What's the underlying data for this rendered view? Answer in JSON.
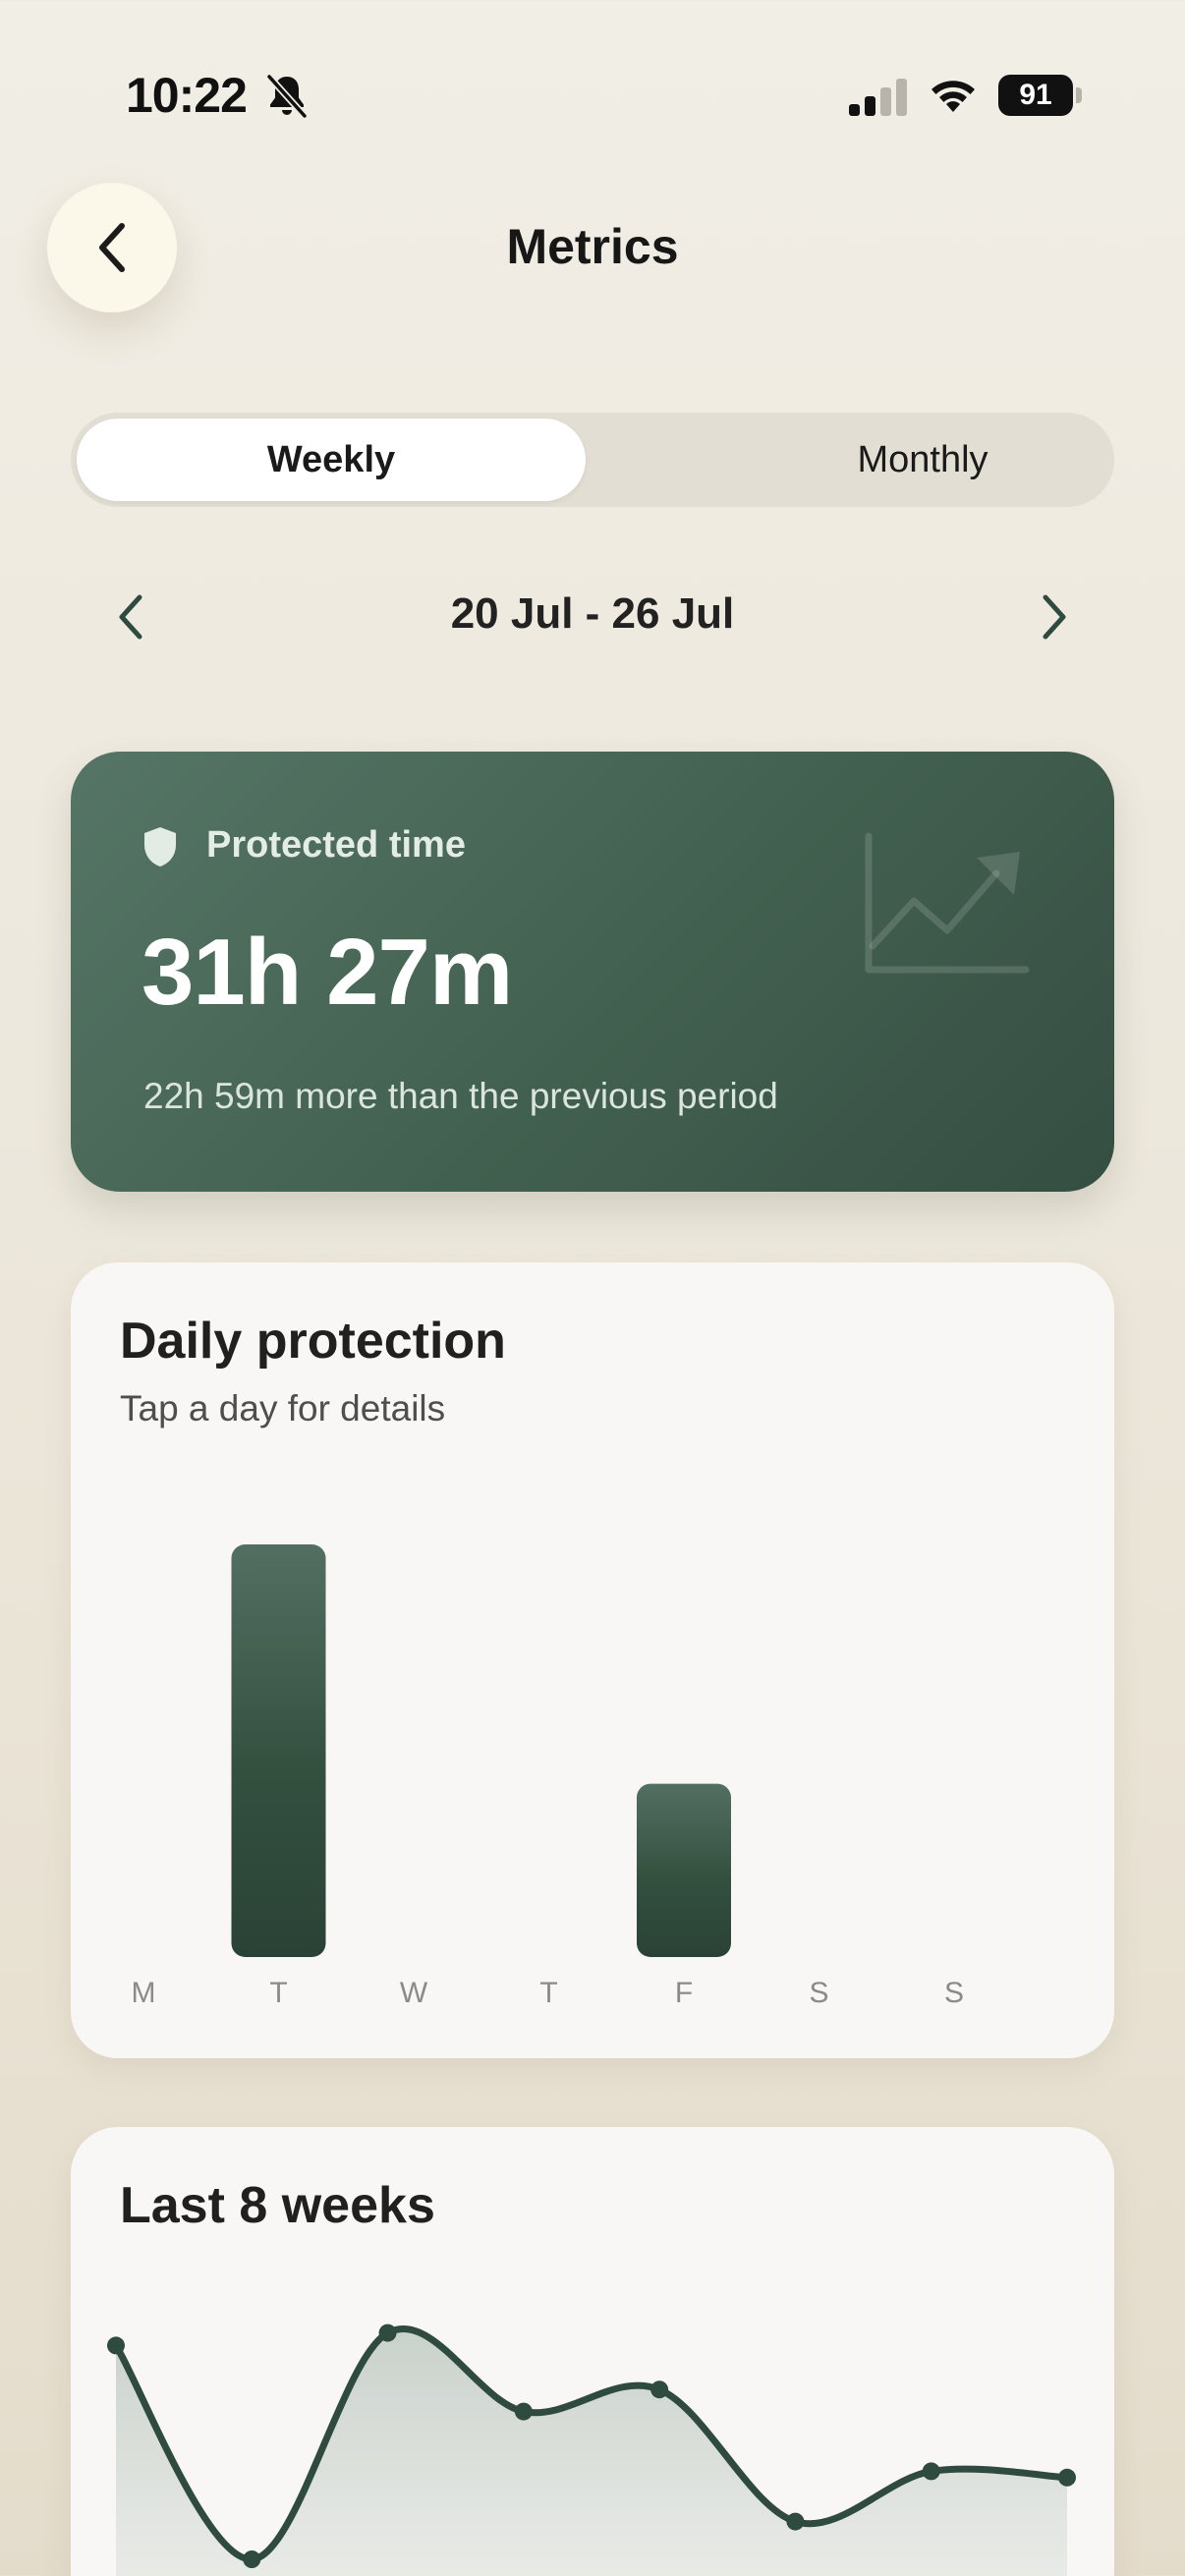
{
  "status_bar": {
    "time": "10:22",
    "battery": "91",
    "icons": [
      "bell-slash-icon",
      "cellular-signal-icon",
      "wifi-icon",
      "battery-icon"
    ]
  },
  "header": {
    "title": "Metrics",
    "back_icon": "chevron-left-icon"
  },
  "period_toggle": {
    "options": [
      "Weekly",
      "Monthly"
    ],
    "selected": "Weekly"
  },
  "date_range": {
    "label": "20 Jul - 26 Jul",
    "prev_icon": "chevron-left-icon",
    "next_icon": "chevron-right-icon"
  },
  "protected_card": {
    "label": "Protected time",
    "value": "31h 27m",
    "comparison": "22h 59m more than the previous period",
    "icons": [
      "shield-icon",
      "trend-up-chart-icon"
    ]
  },
  "daily_card": {
    "title": "Daily protection",
    "subtitle": "Tap a day for details"
  },
  "weeks_card": {
    "title": "Last 8 weeks"
  },
  "colors": {
    "accent": "#2f4a3e",
    "card_green": "#4a685a",
    "background": "#efebe2"
  },
  "chart_data": [
    {
      "type": "bar",
      "title": "Daily protection",
      "categories": [
        "M",
        "T",
        "W",
        "T",
        "F",
        "S",
        "S"
      ],
      "values": [
        0,
        1.0,
        0,
        0,
        0.42,
        0,
        0
      ],
      "grid": false
    },
    {
      "type": "area",
      "title": "Last 8 weeks",
      "x": [
        1,
        2,
        3,
        4,
        5,
        6,
        7,
        8
      ],
      "values": [
        0.93,
        0.25,
        0.97,
        0.72,
        0.79,
        0.37,
        0.53,
        0.51
      ],
      "grid": false
    }
  ]
}
